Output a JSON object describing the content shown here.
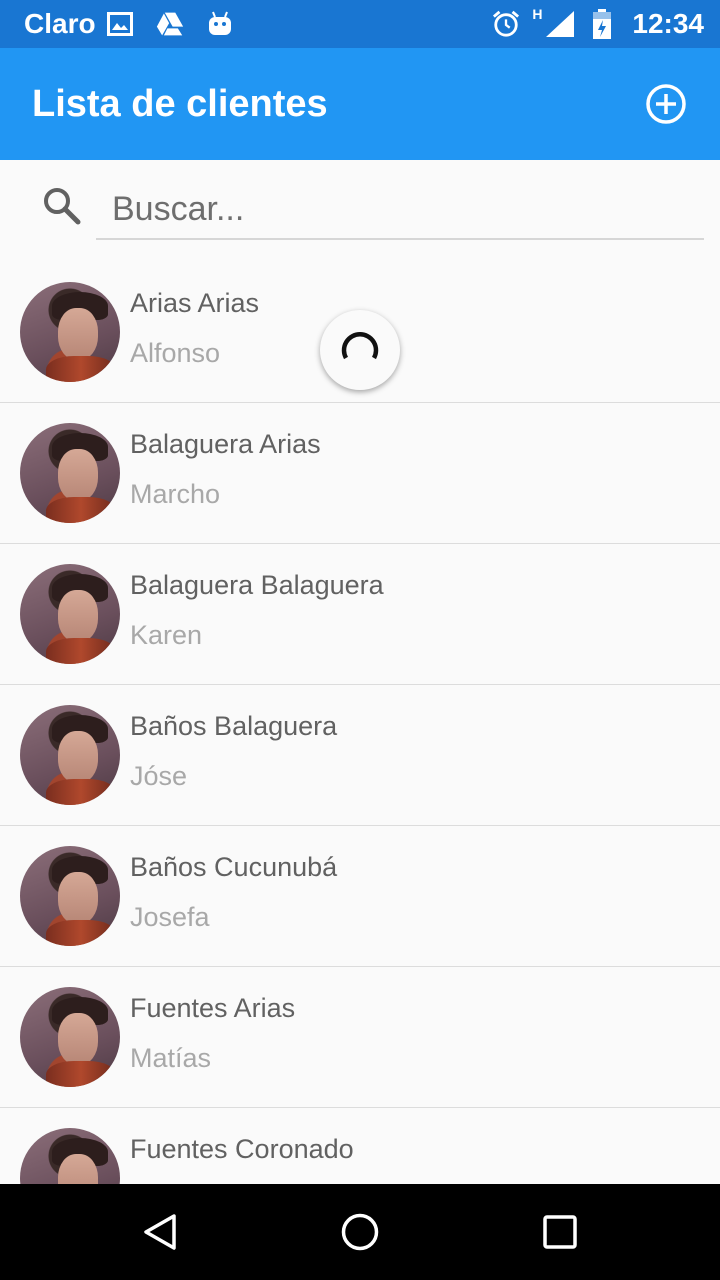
{
  "status_bar": {
    "carrier": "Claro",
    "network_type": "H",
    "time": "12:34",
    "icons": [
      "image-icon",
      "drive-icon",
      "android-icon",
      "alarm-icon",
      "signal-icon",
      "battery-charging-icon"
    ]
  },
  "app_bar": {
    "title": "Lista de clientes",
    "add_icon": "add-circle-icon"
  },
  "search": {
    "placeholder": "Buscar...",
    "value": ""
  },
  "clients": [
    {
      "last_name": "Arias Arias",
      "first_name": "Alfonso"
    },
    {
      "last_name": "Balaguera Arias",
      "first_name": "Marcho"
    },
    {
      "last_name": "Balaguera Balaguera",
      "first_name": "Karen"
    },
    {
      "last_name": "Baños Balaguera",
      "first_name": "Jóse"
    },
    {
      "last_name": "Baños Cucunubá",
      "first_name": "Josefa"
    },
    {
      "last_name": "Fuentes Arias",
      "first_name": "Matías"
    },
    {
      "last_name": "Fuentes Coronado",
      "first_name": ""
    }
  ],
  "colors": {
    "status_bar": "#1976d2",
    "app_bar": "#2196f3",
    "background": "#fafafa",
    "primary_text": "#616161",
    "secondary_text": "#a8a8a8"
  },
  "nav_bar": {
    "icons": [
      "back-icon",
      "home-icon",
      "recents-icon"
    ]
  }
}
